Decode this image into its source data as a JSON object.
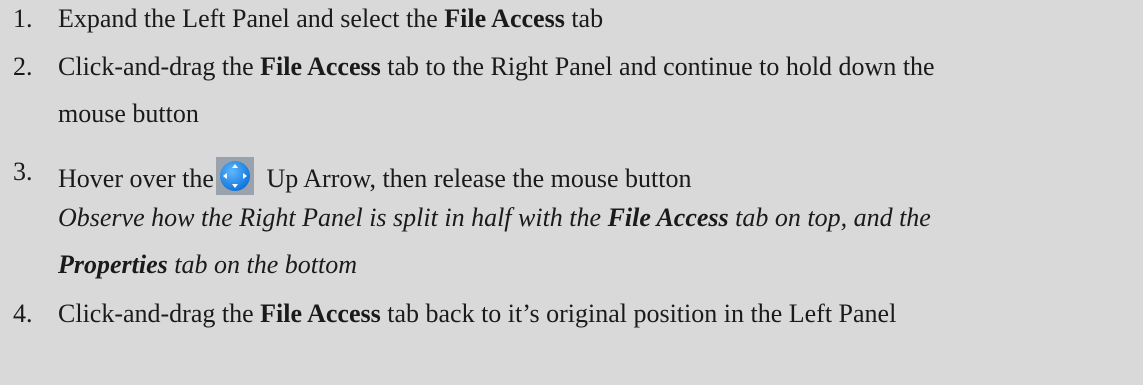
{
  "steps": [
    {
      "number": "1.",
      "pre": "Expand the Left Panel and select the ",
      "bold": "File Access",
      "post": " tab"
    },
    {
      "number": "2.",
      "pre": "Click-and-drag the ",
      "bold": "File Access",
      "post_line1": " tab to the Right Panel and continue to hold down the",
      "line2": "mouse button"
    },
    {
      "number": "3.",
      "pre": "Hover over the",
      "icon": "up-arrow-navigator-icon",
      "post": " Up Arrow, then release the mouse button",
      "obs_line1_pre": "Observe how the Right Panel is split in half with the ",
      "obs_line1_bold": "File Access",
      "obs_line1_post": " tab on top, and the",
      "obs_line2_bold": "Properties",
      "obs_line2_post": " tab on the bottom"
    },
    {
      "number": "4.",
      "pre": "Click-and-drag the ",
      "bold": "File Access",
      "post": " tab back to it’s original position in the Left Panel"
    }
  ],
  "colors": {
    "background": "#d9d9d9",
    "text": "#1a1a1a",
    "icon_fill": "#1e90ff"
  }
}
